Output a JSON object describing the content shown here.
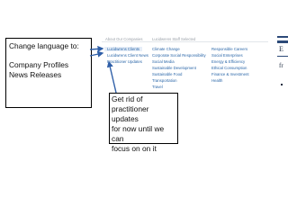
{
  "annotations": {
    "change_language": {
      "title": "Change language to:",
      "line1": "Company Profiles",
      "line2": "News Releases"
    },
    "updates_note": {
      "line1": "Get rid of",
      "line2": "practitioner updates",
      "line3": "for now until we can",
      "line4": "focus on on it"
    }
  },
  "menu": {
    "columns": [
      {
        "header": "About Our Companies",
        "items": [
          "Lucidwrens Clients",
          "Lucidwrens Client News",
          "Practitioner Updates"
        ]
      },
      {
        "header": "Lucidwrens Staff Selected",
        "items": [
          "Climate Change",
          "Corporate Social Responsibility",
          "Social Media",
          "Sustainable Development",
          "Sustainable Food",
          "Transportation",
          "Travel"
        ]
      },
      {
        "header": "",
        "items": [
          "Responsible Careers",
          "Social Enterprises",
          "Energy & Efficiency",
          "Ethical Consumption",
          "Finance & Investment",
          "Health"
        ]
      }
    ]
  },
  "right_strip": {
    "glyph1": "E",
    "glyph2": "fr"
  },
  "colors": {
    "link": "#2a66a8",
    "header": "#9aa0a8",
    "highlight": "#e6eef8",
    "arrow": "#2f5fa8",
    "strip": "#2c4a78"
  }
}
